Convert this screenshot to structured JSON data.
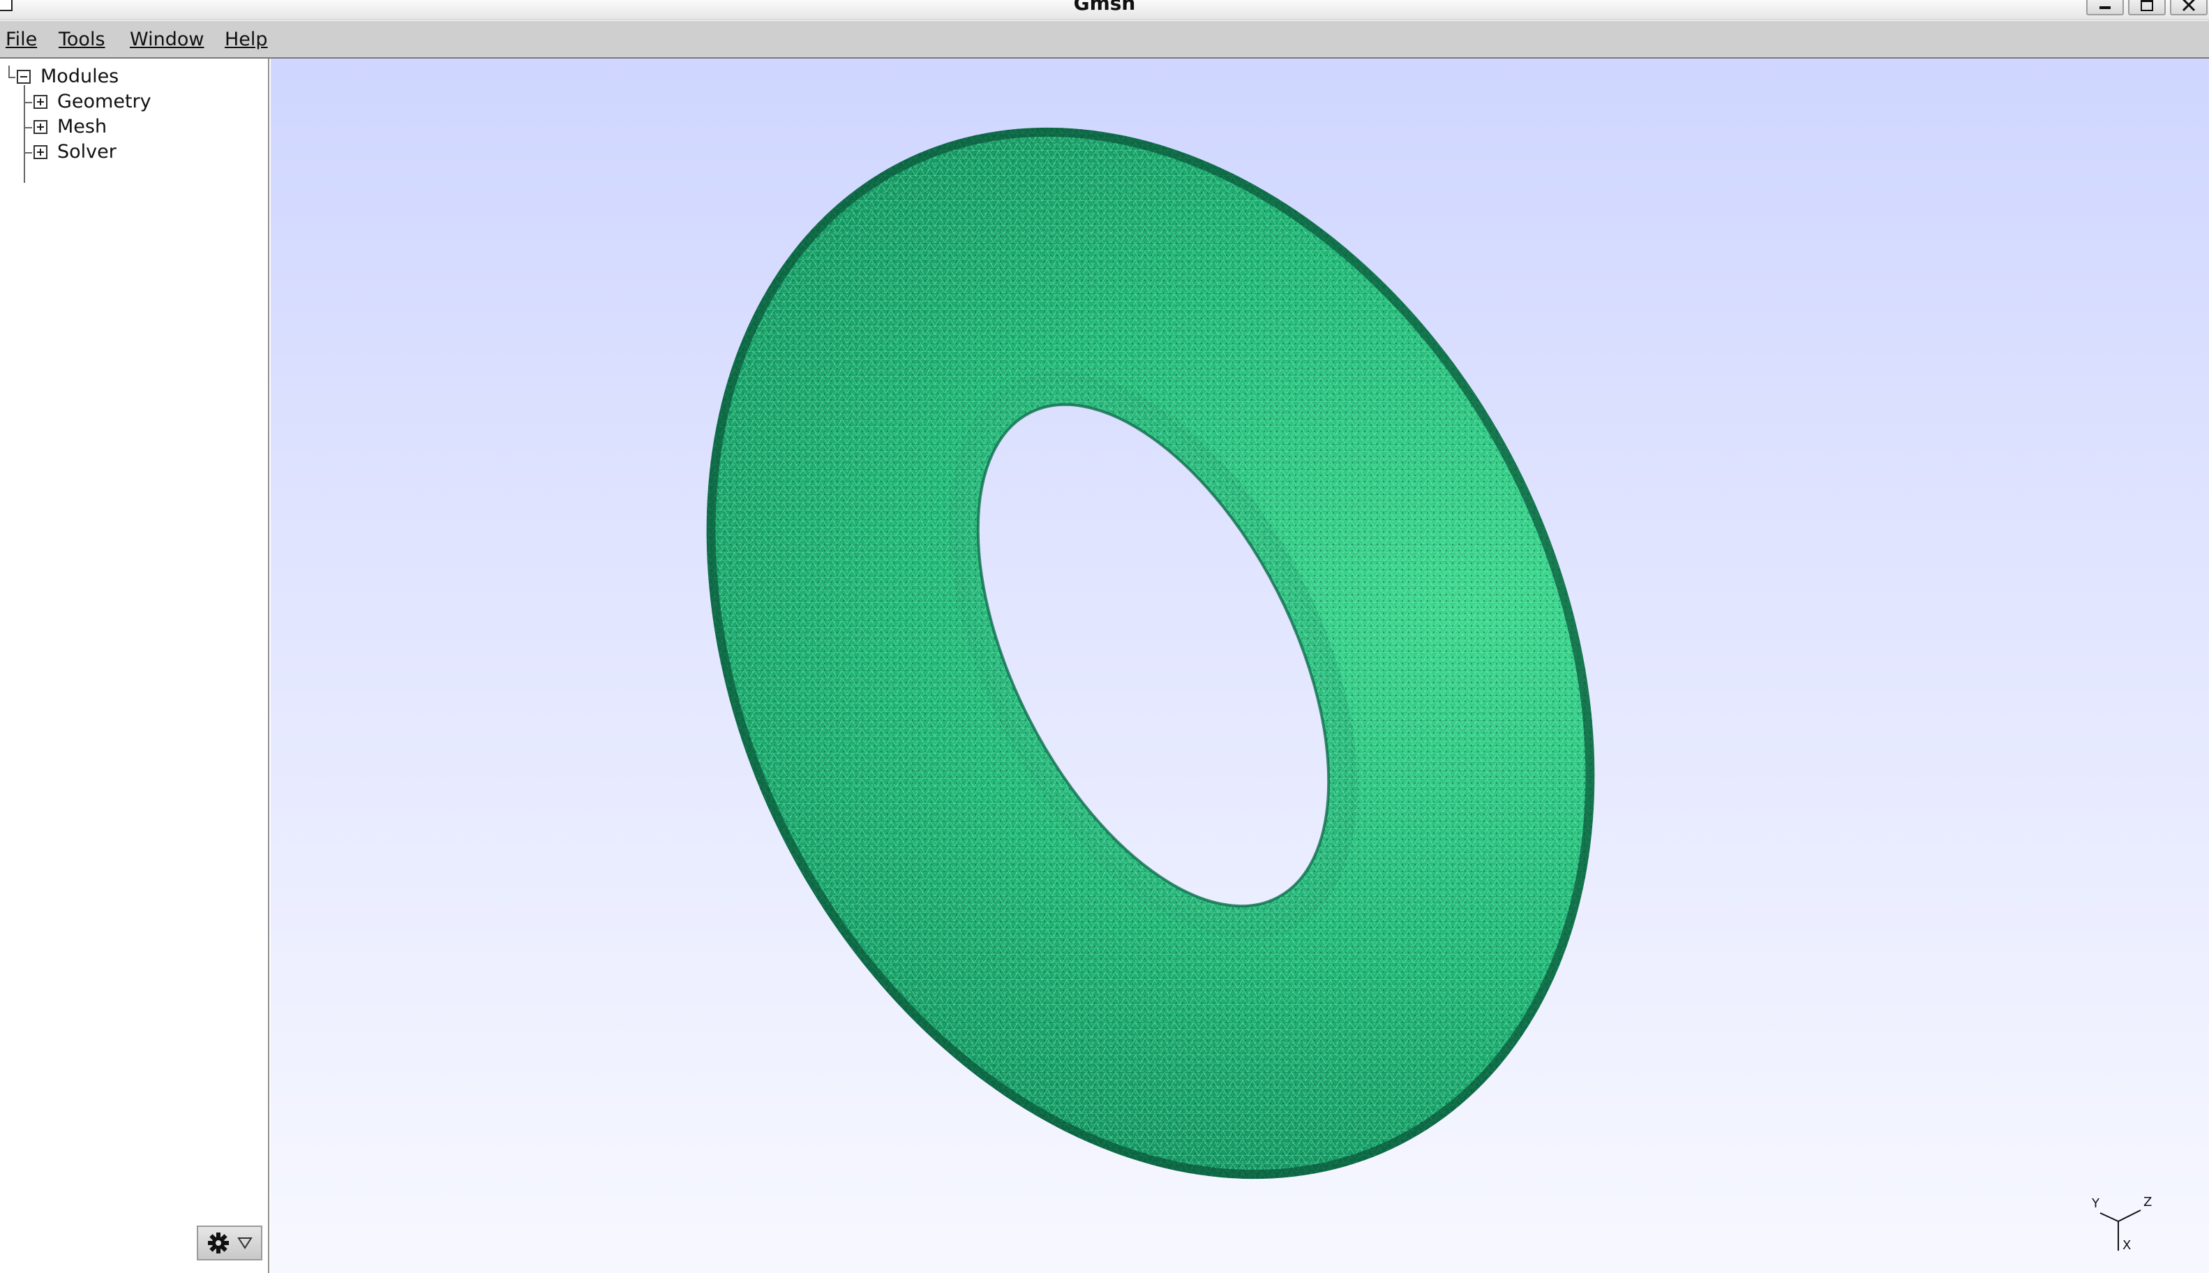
{
  "window": {
    "title": "Gmsh"
  },
  "menu": {
    "file": "File",
    "tools": "Tools",
    "window": "Window",
    "help": "Help"
  },
  "tree": {
    "root": "Modules",
    "children": [
      "Geometry",
      "Mesh",
      "Solver"
    ]
  },
  "viewport": {
    "object": "torus-mesh",
    "colors": {
      "background_top": "#cfd6ff",
      "background_bottom": "#f7f8ff",
      "mesh_dark": "#0b6b4a",
      "mesh_mid": "#18a06a",
      "mesh_light": "#3fd890"
    },
    "axes": {
      "y": "Y",
      "z": "Z",
      "x": "X"
    }
  },
  "icons": {
    "sidebar_gear": "gear-icon",
    "sidebar_dropdown": "triangle-down-icon",
    "minimize": "minimize-icon",
    "maximize": "maximize-icon",
    "close": "close-icon"
  }
}
